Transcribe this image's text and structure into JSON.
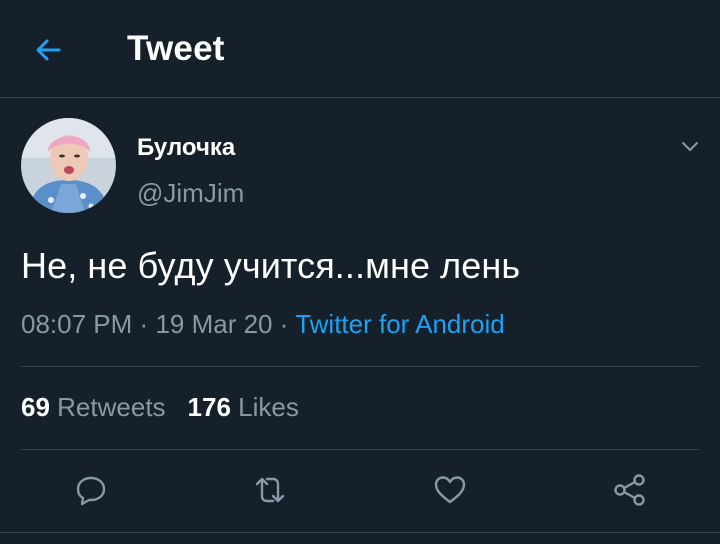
{
  "header": {
    "title": "Tweet",
    "back_icon": "arrow-left-icon"
  },
  "tweet": {
    "author": {
      "display_name": "Булочка",
      "handle": "@JimJim"
    },
    "text": "Не, не буду учится...мне лень",
    "time": "08:07 PM",
    "date": "19 Mar 20",
    "separator": "·",
    "source": "Twitter for Android"
  },
  "stats": {
    "retweets_count": "69",
    "retweets_label": "Retweets",
    "likes_count": "176",
    "likes_label": "Likes"
  },
  "actions": [
    {
      "name": "reply",
      "icon": "reply-icon"
    },
    {
      "name": "retweet",
      "icon": "retweet-icon"
    },
    {
      "name": "like",
      "icon": "heart-icon"
    },
    {
      "name": "share",
      "icon": "share-icon"
    }
  ],
  "colors": {
    "background": "#15202b",
    "accent": "#1da1f2",
    "secondary_text": "#8899a6",
    "divider": "#38444d"
  }
}
